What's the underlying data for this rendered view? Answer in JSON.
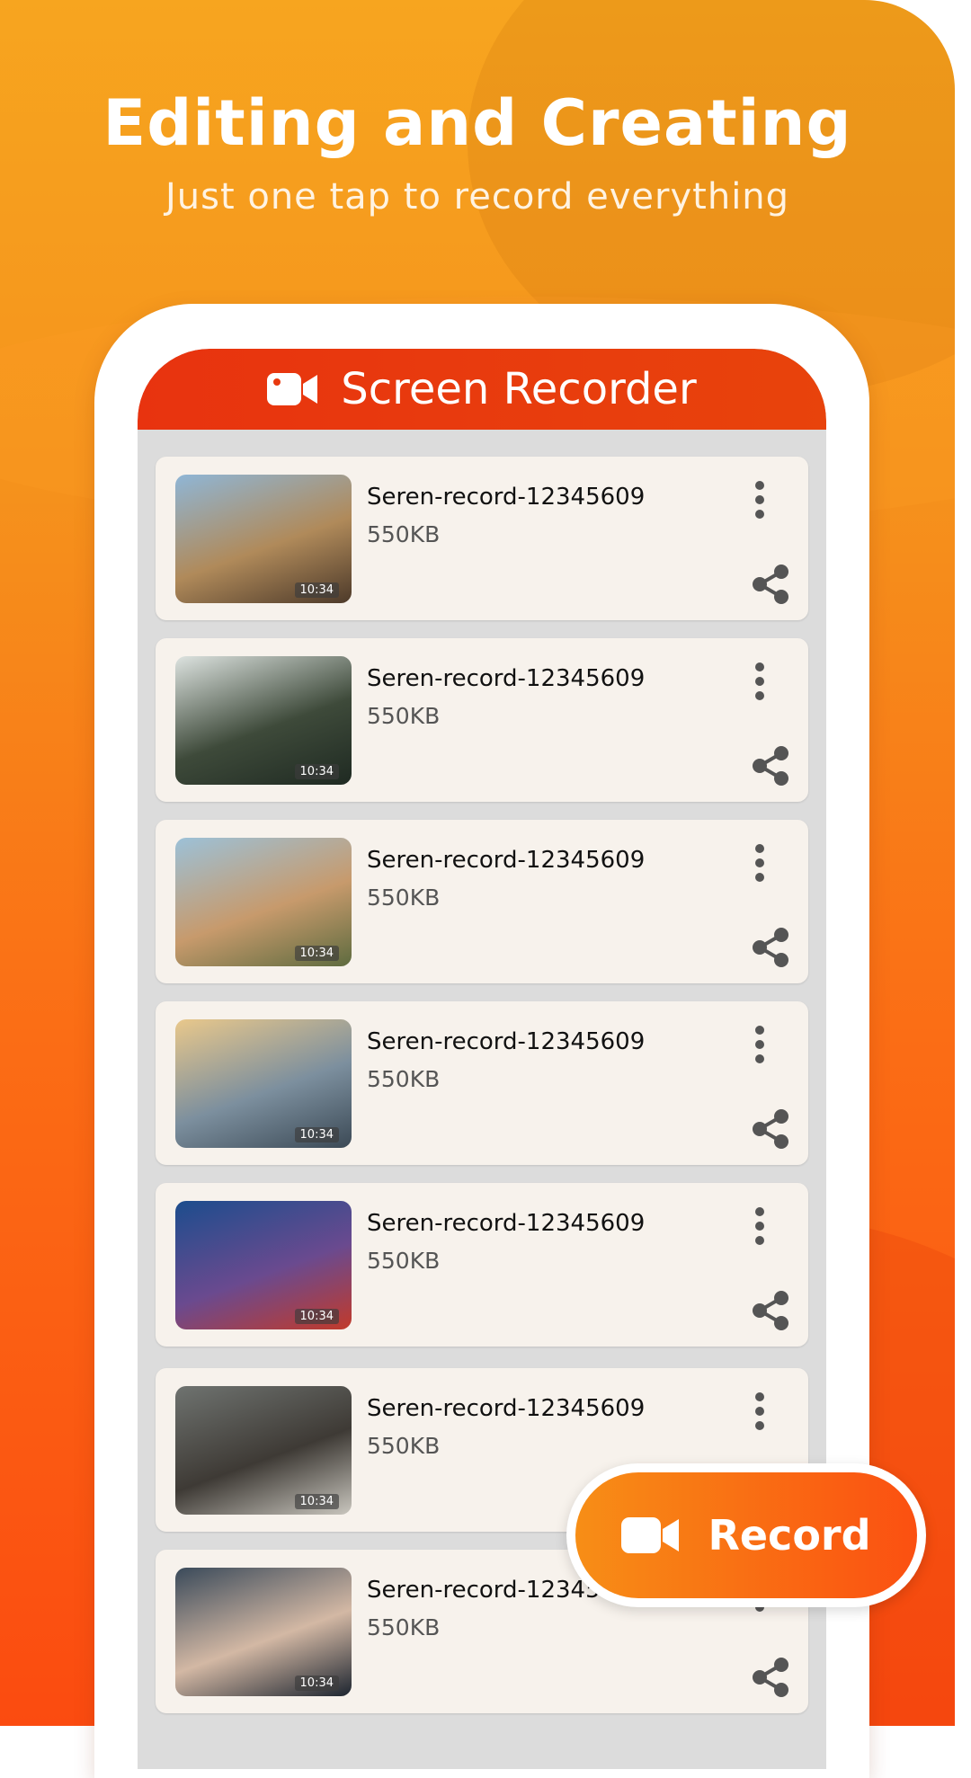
{
  "promo": {
    "headline": "Editing and Creating",
    "subline": "Just one tap to record everything"
  },
  "app": {
    "title": "Screen Recorder",
    "title_icon": "video-camera-icon"
  },
  "recordings": [
    {
      "name": "Seren-record-12345609",
      "size": "550KB",
      "duration": "10:34",
      "thumb_colors": [
        "#8fb6d6",
        "#b08a5a",
        "#4d3a2a"
      ]
    },
    {
      "name": "Seren-record-12345609",
      "size": "550KB",
      "duration": "10:34",
      "thumb_colors": [
        "#dde3e0",
        "#3e4a3a",
        "#1f2a22"
      ]
    },
    {
      "name": "Seren-record-12345609",
      "size": "550KB",
      "duration": "10:34",
      "thumb_colors": [
        "#9cc1d8",
        "#c79a6c",
        "#5e6b3f"
      ]
    },
    {
      "name": "Seren-record-12345609",
      "size": "550KB",
      "duration": "10:34",
      "thumb_colors": [
        "#e9c88b",
        "#7c8f9e",
        "#3c4a56"
      ]
    },
    {
      "name": "Seren-record-12345609",
      "size": "550KB",
      "duration": "10:34",
      "thumb_colors": [
        "#1c4d8d",
        "#6a4a8f",
        "#c23a2a"
      ]
    },
    {
      "name": "Seren-record-12345609",
      "size": "550KB",
      "duration": "10:34",
      "thumb_colors": [
        "#6f7370",
        "#3e3a35",
        "#c9c6be"
      ]
    },
    {
      "name": "Seren-record-12345609",
      "size": "550KB",
      "duration": "10:34",
      "thumb_colors": [
        "#3a4a5a",
        "#d3b8a4",
        "#1d2530"
      ]
    }
  ],
  "record_button": {
    "label": "Record",
    "icon": "video-camera-icon"
  },
  "colors": {
    "accent": "#e8380e",
    "record_gradient_start": "#f78e16",
    "record_gradient_end": "#fb5011",
    "card_bg": "#f7f2ec",
    "icon_gray": "#555555"
  }
}
